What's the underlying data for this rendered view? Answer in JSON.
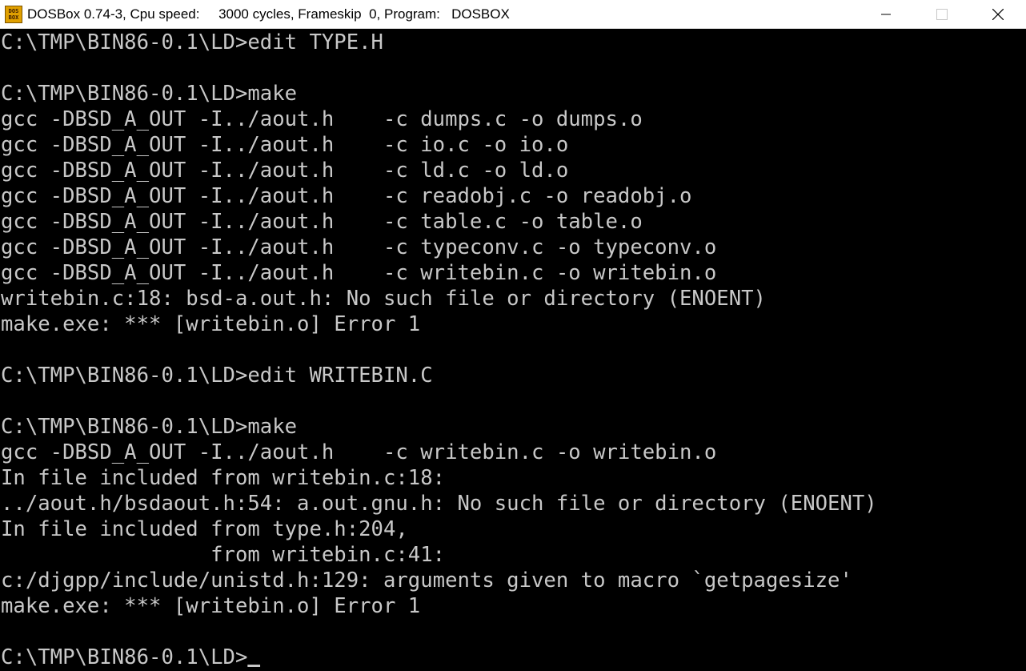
{
  "titlebar": {
    "icon_label_top": "DOS",
    "icon_label_bottom": "BOX",
    "title": "DOSBox 0.74-3, Cpu speed:     3000 cycles, Frameskip  0, Program:   DOSBOX",
    "controls": {
      "minimize": "minimize-icon",
      "maximize": "maximize-icon",
      "close": "close-icon"
    }
  },
  "console": {
    "lines": [
      "C:\\TMP\\BIN86-0.1\\LD>edit TYPE.H",
      "",
      "C:\\TMP\\BIN86-0.1\\LD>make",
      "gcc -DBSD_A_OUT -I../aout.h    -c dumps.c -o dumps.o",
      "gcc -DBSD_A_OUT -I../aout.h    -c io.c -o io.o",
      "gcc -DBSD_A_OUT -I../aout.h    -c ld.c -o ld.o",
      "gcc -DBSD_A_OUT -I../aout.h    -c readobj.c -o readobj.o",
      "gcc -DBSD_A_OUT -I../aout.h    -c table.c -o table.o",
      "gcc -DBSD_A_OUT -I../aout.h    -c typeconv.c -o typeconv.o",
      "gcc -DBSD_A_OUT -I../aout.h    -c writebin.c -o writebin.o",
      "writebin.c:18: bsd-a.out.h: No such file or directory (ENOENT)",
      "make.exe: *** [writebin.o] Error 1",
      "",
      "C:\\TMP\\BIN86-0.1\\LD>edit WRITEBIN.C",
      "",
      "C:\\TMP\\BIN86-0.1\\LD>make",
      "gcc -DBSD_A_OUT -I../aout.h    -c writebin.c -o writebin.o",
      "In file included from writebin.c:18:",
      "../aout.h/bsdaout.h:54: a.out.gnu.h: No such file or directory (ENOENT)",
      "In file included from type.h:204,",
      "                 from writebin.c:41:",
      "c:/djgpp/include/unistd.h:129: arguments given to macro `getpagesize'",
      "make.exe: *** [writebin.o] Error 1",
      "",
      "C:\\TMP\\BIN86-0.1\\LD>"
    ]
  },
  "colors": {
    "console_bg": "#000000",
    "console_fg": "#c8c8c8",
    "titlebar_bg": "#ffffff"
  }
}
